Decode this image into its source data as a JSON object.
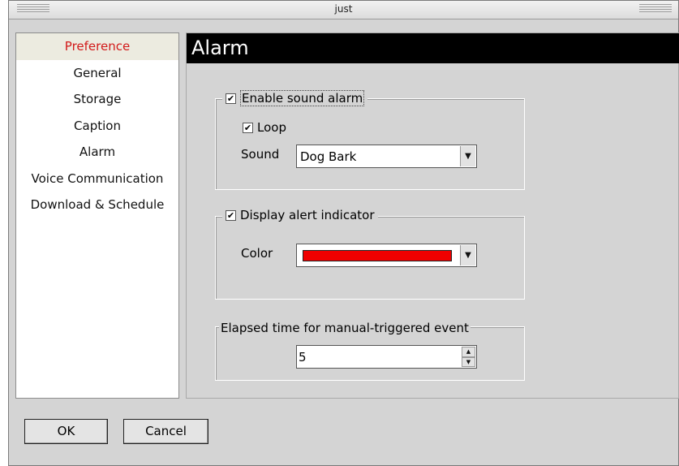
{
  "window": {
    "title": "just"
  },
  "nav": {
    "items": [
      {
        "label": "Preference",
        "active": true
      },
      {
        "label": "General"
      },
      {
        "label": "Storage"
      },
      {
        "label": "Caption"
      },
      {
        "label": "Alarm"
      },
      {
        "label": "Voice Communication"
      },
      {
        "label": "Download & Schedule"
      }
    ]
  },
  "page": {
    "title": "Alarm"
  },
  "sound_alarm": {
    "label": "Enable sound alarm",
    "enabled": true,
    "loop_label": "Loop",
    "loop": true,
    "sound_label": "Sound",
    "sound_value": "Dog Bark"
  },
  "alert_indicator": {
    "label": "Display alert indicator",
    "enabled": true,
    "color_label": "Color",
    "color_value": "#f00000"
  },
  "elapsed": {
    "label": "Elapsed time for manual-triggered event",
    "value": "5"
  },
  "buttons": {
    "ok": "OK",
    "cancel": "Cancel"
  }
}
